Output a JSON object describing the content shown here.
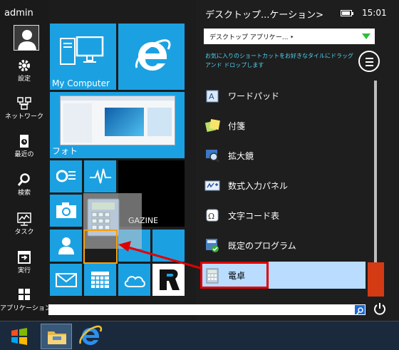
{
  "user": {
    "name": "admin"
  },
  "sidebar": {
    "items": [
      {
        "label": "設定",
        "icon": "gear-icon"
      },
      {
        "label": "ネットワーク",
        "icon": "network-icon"
      },
      {
        "label": "最近の",
        "icon": "recent-icon"
      },
      {
        "label": "検索",
        "icon": "search-icon"
      },
      {
        "label": "タスク",
        "icon": "task-icon"
      },
      {
        "label": "実行",
        "icon": "run-icon"
      },
      {
        "label": "アプリケーション",
        "icon": "apps-icon"
      }
    ]
  },
  "tiles": {
    "my_computer": "My Computer",
    "photos": "フォト",
    "magazine": "GAZINE"
  },
  "panel": {
    "title": "デスクトップ...ケーション>",
    "time": "15:01",
    "dropdown_value": "デスクトップ アプリケー... ‣",
    "hint": "お気に入りのショートカットをお好きなタイルにドラッグ アンド ドロップします"
  },
  "programs": [
    {
      "label": "ワードパッド",
      "icon": "wordpad-icon"
    },
    {
      "label": "付箋",
      "icon": "sticky-notes-icon"
    },
    {
      "label": "拡大鏡",
      "icon": "magnifier-icon"
    },
    {
      "label": "数式入力パネル",
      "icon": "math-input-icon"
    },
    {
      "label": "文字コード表",
      "icon": "charmap-icon"
    },
    {
      "label": "既定のプログラム",
      "icon": "default-programs-icon"
    },
    {
      "label": "電卓",
      "icon": "calculator-icon",
      "selected": true
    }
  ],
  "colors": {
    "tile_blue": "#1ba1e2",
    "highlight_red": "#e00000",
    "scroll_orange": "#d43a14",
    "selected_bg": "#b9dcff"
  }
}
